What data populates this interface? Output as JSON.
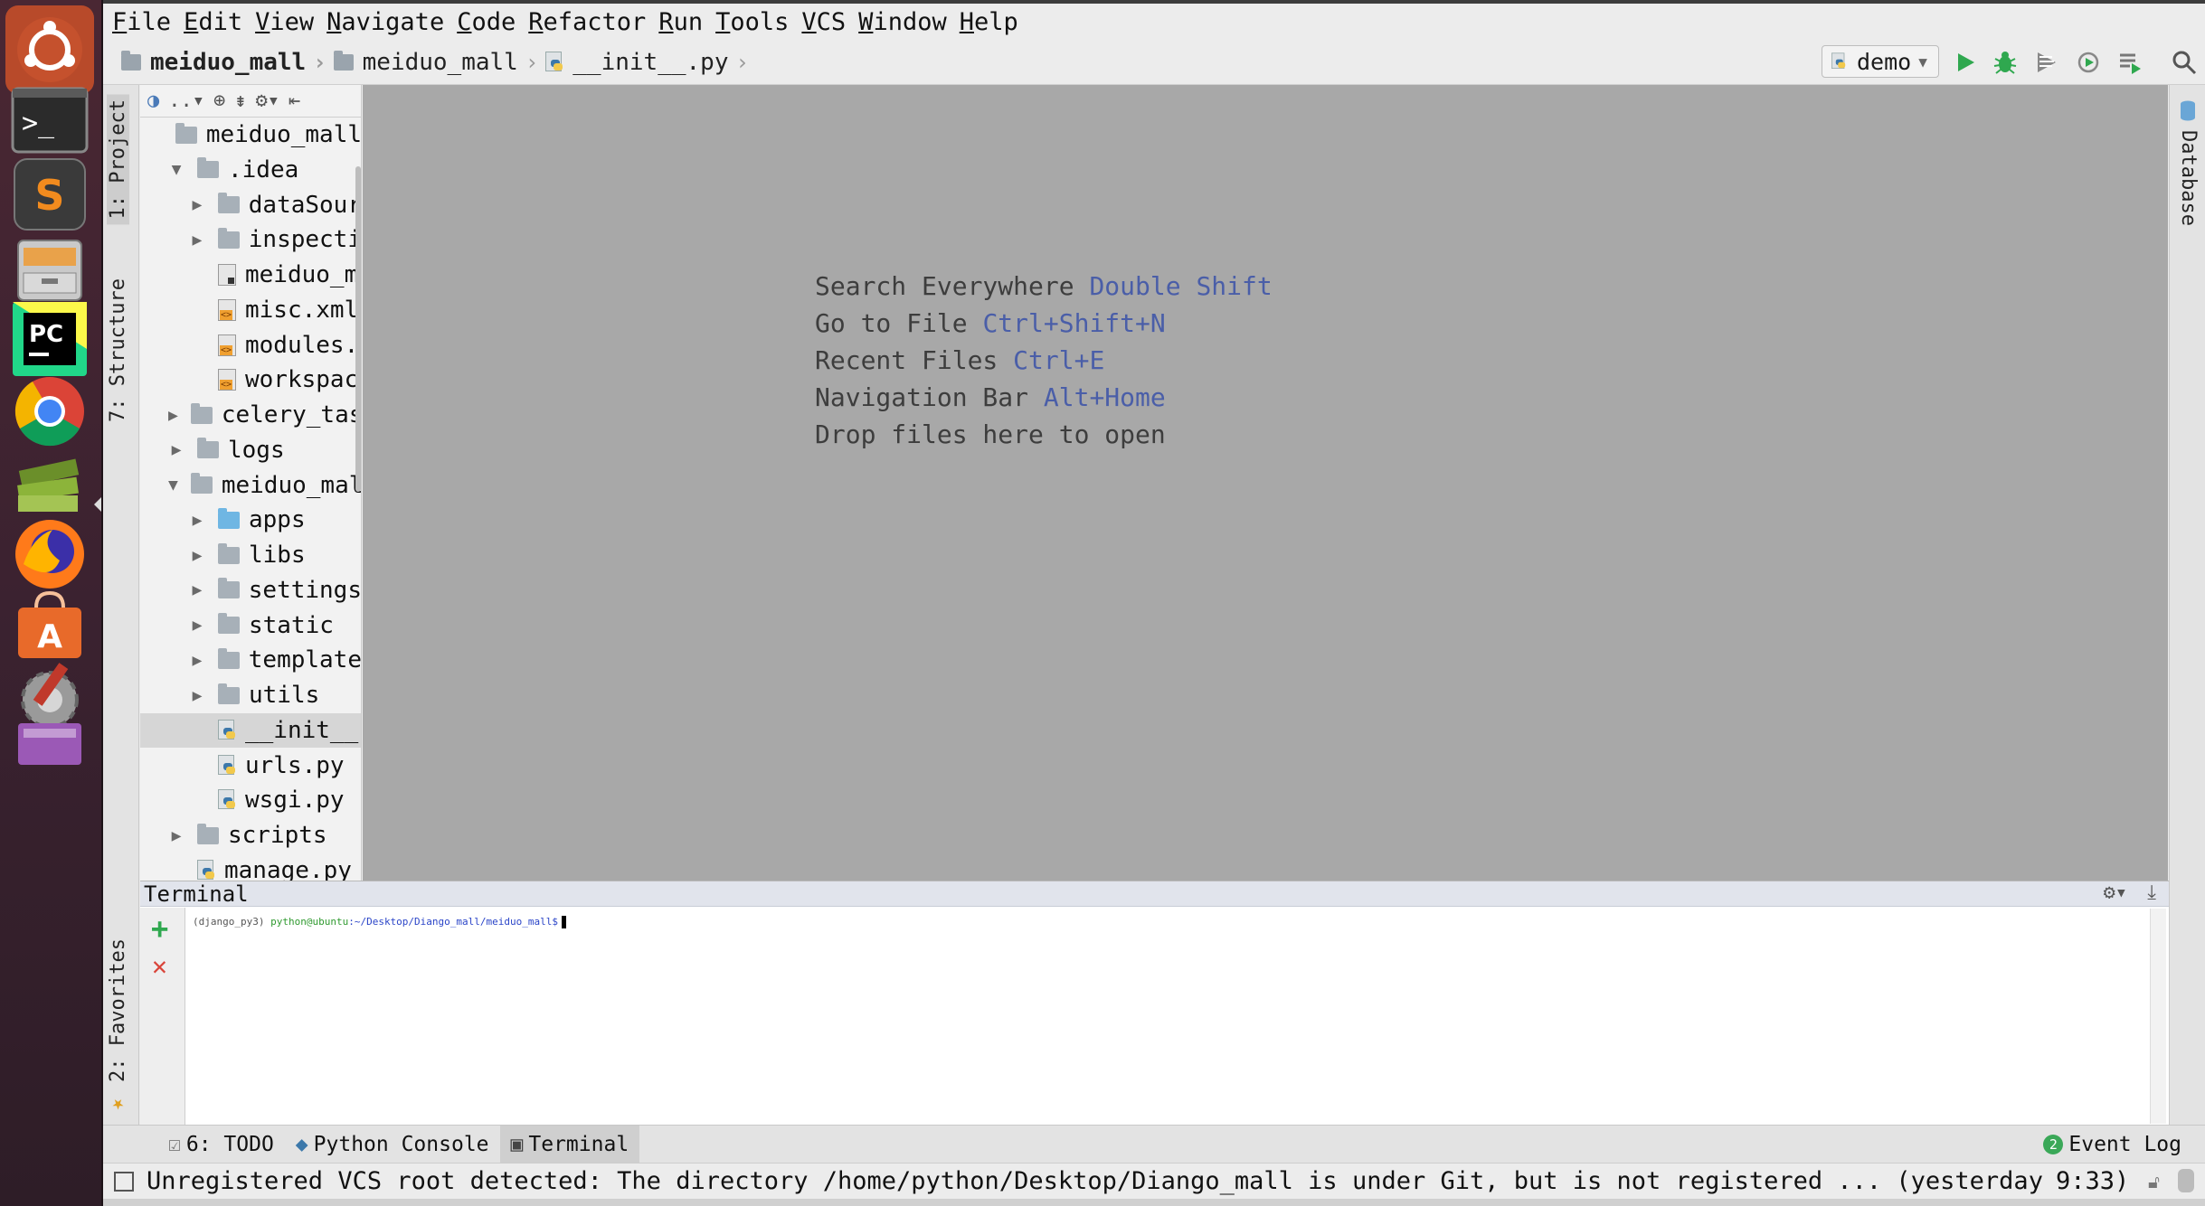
{
  "launcher": {
    "items": [
      {
        "name": "ubuntu-dash",
        "icon": "ubuntu-logo-icon"
      },
      {
        "name": "terminal",
        "icon": "terminal-icon"
      },
      {
        "name": "sublime-text",
        "icon": "sublime-text-icon",
        "letter": "S"
      },
      {
        "name": "files",
        "icon": "file-cabinet-icon"
      },
      {
        "name": "pycharm",
        "icon": "pycharm-icon",
        "letter": "PC"
      },
      {
        "name": "chrome",
        "icon": "chrome-icon"
      },
      {
        "name": "ebook-reader",
        "icon": "books-icon"
      },
      {
        "name": "firefox",
        "icon": "firefox-icon"
      },
      {
        "name": "software-center",
        "icon": "shopping-bag-icon",
        "letter": "A"
      },
      {
        "name": "system-settings",
        "icon": "settings-wrench-icon"
      },
      {
        "name": "workspace-switcher",
        "icon": "workspace-icon"
      }
    ]
  },
  "menubar": {
    "items": [
      "File",
      "Edit",
      "View",
      "Navigate",
      "Code",
      "Refactor",
      "Run",
      "Tools",
      "VCS",
      "Window",
      "Help"
    ]
  },
  "navbar": {
    "crumbs": [
      "meiduo_mall",
      "meiduo_mall",
      "__init__.py"
    ],
    "run_config": "demo"
  },
  "left_strip": {
    "project_tab": "1: Project",
    "structure_tab": "7: Structure",
    "favorites_tab": "2: Favorites"
  },
  "right_strip": {
    "database_tab": "Database"
  },
  "project": {
    "toolbar": "..▾",
    "tree": [
      {
        "label": "meiduo_mall",
        "level": 0,
        "type": "folder",
        "toggle": ""
      },
      {
        "label": ".idea",
        "level": 1,
        "type": "folder",
        "toggle": "▼"
      },
      {
        "label": "dataSour",
        "level": 2,
        "type": "folder",
        "toggle": "▶"
      },
      {
        "label": "inspecti",
        "level": 2,
        "type": "folder",
        "toggle": "▶"
      },
      {
        "label": "meiduo_m",
        "level": 2,
        "type": "doc",
        "toggle": ""
      },
      {
        "label": "misc.xml",
        "level": 2,
        "type": "xml",
        "toggle": ""
      },
      {
        "label": "modules.",
        "level": 2,
        "type": "xml",
        "toggle": ""
      },
      {
        "label": "workspac",
        "level": 2,
        "type": "xml",
        "toggle": ""
      },
      {
        "label": "celery_tas",
        "level": 1,
        "type": "folder",
        "toggle": "▶"
      },
      {
        "label": "logs",
        "level": 1,
        "type": "folder",
        "toggle": "▶"
      },
      {
        "label": "meiduo_mal",
        "level": 1,
        "type": "folder",
        "toggle": "▼"
      },
      {
        "label": "apps",
        "level": 2,
        "type": "folder-blue",
        "toggle": "▶"
      },
      {
        "label": "libs",
        "level": 2,
        "type": "folder",
        "toggle": "▶"
      },
      {
        "label": "settings",
        "level": 2,
        "type": "folder",
        "toggle": "▶"
      },
      {
        "label": "static",
        "level": 2,
        "type": "folder",
        "toggle": "▶"
      },
      {
        "label": "template",
        "level": 2,
        "type": "folder",
        "toggle": "▶"
      },
      {
        "label": "utils",
        "level": 2,
        "type": "folder",
        "toggle": "▶"
      },
      {
        "label": "__init__",
        "level": 2,
        "type": "py",
        "toggle": "",
        "selected": true
      },
      {
        "label": "urls.py",
        "level": 2,
        "type": "py",
        "toggle": ""
      },
      {
        "label": "wsgi.py",
        "level": 2,
        "type": "py",
        "toggle": ""
      },
      {
        "label": "scripts",
        "level": 1,
        "type": "folder",
        "toggle": "▶"
      },
      {
        "label": "manage.py",
        "level": 1,
        "type": "py",
        "toggle": ""
      }
    ]
  },
  "editor": {
    "hints": [
      {
        "text": "Search Everywhere",
        "key": "Double Shift"
      },
      {
        "text": "Go to File",
        "key": "Ctrl+Shift+N"
      },
      {
        "text": "Recent Files",
        "key": "Ctrl+E"
      },
      {
        "text": "Navigation Bar",
        "key": "Alt+Home"
      },
      {
        "text": "Drop files here to open",
        "key": ""
      }
    ]
  },
  "terminal": {
    "title": "Terminal",
    "prompt_env": "(django_py3)",
    "prompt_user": "python@ubuntu",
    "prompt_path": ":~/Desktop/Diango_mall/meiduo_mall$"
  },
  "bottom_tabs": {
    "todo": "6: TODO",
    "python_console": "Python Console",
    "terminal": "Terminal",
    "event_log": "Event Log",
    "event_count": "2"
  },
  "status": {
    "message": "Unregistered VCS root detected: The directory /home/python/Desktop/Diango_mall is under Git, but is not registered ... (yesterday",
    "time": "9:33)"
  },
  "colors": {
    "launcher_bg": "#3b2230",
    "editor_bg": "#a8a8a8",
    "hint_key": "#4a5ea8",
    "terminal_header": "#e1e4ec",
    "run_green": "#2fa84f"
  }
}
